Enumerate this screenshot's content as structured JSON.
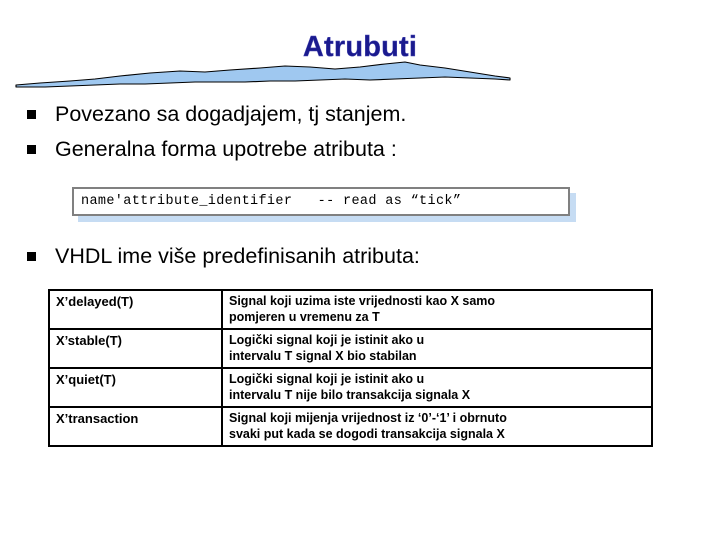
{
  "slide": {
    "title": "Atrubuti",
    "title_color": "#1a1a8e",
    "wave_fill": "#9fc8f0",
    "wave_stroke": "#000000"
  },
  "bullets": [
    {
      "marker": "square-bullet",
      "text": "Povezano sa dogadjajem, tj stanjem."
    },
    {
      "marker": "square-bullet",
      "text": "Generalna forma upotrebe atributa :"
    },
    {
      "marker": "square-bullet",
      "text": "VHDL ime više predefinisanih atributa:"
    }
  ],
  "code_box": {
    "text": "name'attribute_identifier   -- read as “tick”",
    "border_color": "#808080",
    "shadow_color": "#c6dcf3"
  },
  "table": {
    "rows": [
      {
        "name": "X’delayed(T)",
        "description_lines": [
          "Signal koji uzima iste vrijednosti kao X samo",
          "pomjeren u vremenu za T"
        ]
      },
      {
        "name": "X’stable(T)",
        "description_lines": [
          "Logički signal koji je istinit ako u",
          "intervalu T signal X bio stabilan"
        ]
      },
      {
        "name": "X’quiet(T)",
        "description_lines": [
          "Logički signal koji je istinit ako u",
          "intervalu T nije bilo transakcija signala X"
        ]
      },
      {
        "name": "X’transaction",
        "description_lines": [
          "Signal koji mijenja vrijednost iz ‘0’-‘1’ i obrnuto",
          "svaki put kada se dogodi transakcija signala X"
        ]
      }
    ]
  }
}
